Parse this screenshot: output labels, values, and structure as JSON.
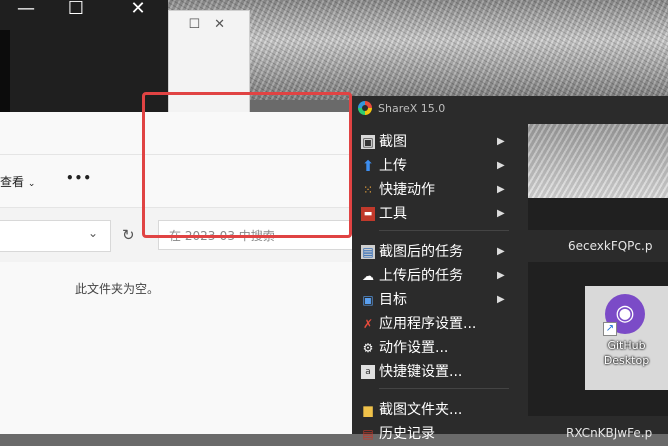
{
  "sharex": {
    "title": "ShareX 15.0",
    "file1": "6ecexkFQPc.p",
    "file2": "RXCnKBJwFe.p",
    "shortcut_line1": "GitHub",
    "shortcut_line2": "Desktop"
  },
  "menu": {
    "items": [
      {
        "label": "截图",
        "icon": "camera-icon",
        "submenu": true
      },
      {
        "label": "上传",
        "icon": "upload-arrow-icon",
        "submenu": true
      },
      {
        "label": "快捷动作",
        "icon": "grid-dots-icon",
        "submenu": true
      },
      {
        "label": "工具",
        "icon": "toolbox-icon",
        "submenu": true
      },
      {
        "label": "截图后的任务",
        "icon": "monitor-icon",
        "submenu": true
      },
      {
        "label": "上传后的任务",
        "icon": "cloud-upload-icon",
        "submenu": true
      },
      {
        "label": "目标",
        "icon": "monitor-target-icon",
        "submenu": true
      },
      {
        "label": "应用程序设置...",
        "icon": "wrench-icon",
        "submenu": false
      },
      {
        "label": "动作设置...",
        "icon": "gear-icon",
        "submenu": false
      },
      {
        "label": "快捷键设置...",
        "icon": "keyboard-icon",
        "submenu": false
      },
      {
        "label": "截图文件夹...",
        "icon": "folder-icon",
        "submenu": false
      },
      {
        "label": "历史记录",
        "icon": "history-icon",
        "submenu": false
      }
    ]
  },
  "explorer": {
    "view_label": "查看",
    "more_label": "•••",
    "search_placeholder": "在 2023-03 中搜索",
    "empty_text": "此文件夹为空。"
  },
  "colors": {
    "highlight_box": "#e04343",
    "sharex_bg": "#2b2b2b"
  }
}
